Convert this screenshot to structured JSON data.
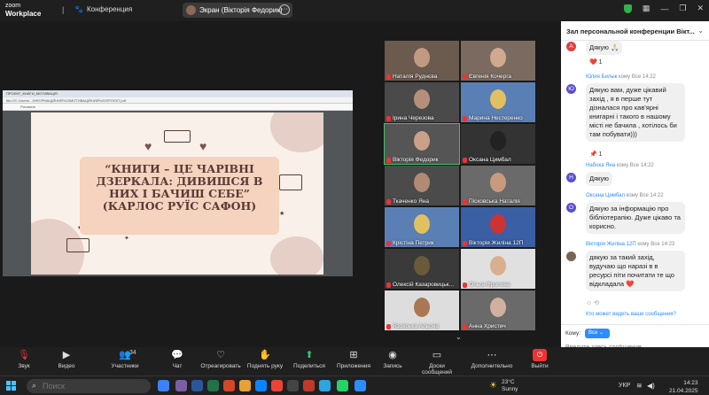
{
  "window": {
    "logo_line1": "zoom",
    "logo_line2": "Workplace",
    "conference_label": "Конференция",
    "screen_share_label": "Экран (Вікторія Федорик)"
  },
  "shared_screen": {
    "tab_title": "ПРОЄКТ_КНИГИ_МОТИВАЦІЯ",
    "address": "file:///C:/Users/...ІНФОРМАЦІЙНИЙ%20МОТИВАЦІЙНИЙ%20ПРОЄКТ.pdf",
    "pdf_toolbar": "Рисовать",
    "quote_line1": "“КНИГИ – ЦЕ ЧАРІВНІ",
    "quote_line2": "ДЗЕРКАЛА: ДИВИШСЯ В",
    "quote_line3": "НИХ І БАЧИШ СЕБЕ”",
    "quote_line4": "(КАРЛОС РУЇС САФОН)"
  },
  "participants": [
    {
      "name": "Наталія Руднєва",
      "face": "#c29a82",
      "bg": "#6b5a4e"
    },
    {
      "name": "Євгенія Кочерга",
      "face": "#d1a98f",
      "bg": "#7a6a60"
    },
    {
      "name": "Ірина Черезова",
      "face": "#b58f7a",
      "bg": "#4a4a4a"
    },
    {
      "name": "Марина Нестеренко",
      "face": "#e0c060",
      "bg": "#5a7fb5"
    },
    {
      "name": "Вікторія Федорик",
      "face": "#caa088",
      "bg": "#555"
    },
    {
      "name": "Оксана Цимбал",
      "face": "#222",
      "bg": "#333"
    },
    {
      "name": "Ткаченко Яна",
      "face": "#b08a72",
      "bg": "#4b4b4b"
    },
    {
      "name": "Пісковська Наталія",
      "face": "#c99a7e",
      "bg": "#6a6a6a"
    },
    {
      "name": "Крістіна Петрик",
      "face": "#e0c060",
      "bg": "#5a7fb5"
    },
    {
      "name": "Вікторія Жиліна 12П",
      "face": "#cc3333",
      "bg": "#3a5fa5"
    },
    {
      "name": "Олексій Казаровицьк...",
      "face": "#6a5a3a",
      "bg": "#3a3a3a"
    },
    {
      "name": "Ольга Фролова",
      "face": "#d8b090",
      "bg": "#e0e0e0"
    },
    {
      "name": "Язовська Альона",
      "face": "#aa7755",
      "bg": "#dddddd"
    },
    {
      "name": "Анна Христич",
      "face": "#d0b0a0",
      "bg": "#6a6a6a"
    }
  ],
  "chat": {
    "title": "Зал персональной конференции Вікт...",
    "messages": [
      {
        "avatar": "А",
        "avatar_color": "#e04040",
        "sender": "",
        "meta": "",
        "text": "Дякую 🙏🏻",
        "reaction": "❤️ 1"
      },
      {
        "avatar": "Ю",
        "avatar_color": "#5a4fcf",
        "sender": "Юлия Билык",
        "meta": " кому Все  14:22",
        "text": "Дякую вам, дуже цікавий захід , я в перше тут дізналася  про кав'ярні книгарні і такого в нашому місті не бачила , хотілось би там побувати)))",
        "reaction": "📌 1"
      },
      {
        "avatar": "Н",
        "avatar_color": "#5a4fcf",
        "sender": "Набока Яна",
        "meta": " кому Все  14:22",
        "text": "Дякую",
        "reaction": ""
      },
      {
        "avatar": "О",
        "avatar_color": "#5a4fcf",
        "sender": "Оксана Цимбал",
        "meta": " кому Все  14:22",
        "text": "Дякую за інформацію про бібліотерапію. Дуже цікаво та корисно.",
        "reaction": ""
      },
      {
        "avatar": "",
        "avatar_color": "#776655",
        "sender": "Вікторія Жиліна 12П",
        "meta": " кому Все  14:23",
        "text": "дякую за такий захід, вудучаю що наразі в в ресурсі піти почитати те що відкладала ❤️",
        "reaction": ""
      }
    ],
    "who_can_see": "Кто может видеть ваши сообщения?",
    "to_label": "Кому:",
    "to_value": "Все",
    "input_placeholder": "Введите здесь сообщение..."
  },
  "toolbar": {
    "audio": "Звук",
    "video": "Видео",
    "participants": "Участники",
    "participants_count": "34",
    "chat": "Чат",
    "react": "Отреагировать",
    "raise_hand": "Поднять руку",
    "share": "Поделиться",
    "apps": "Приложения",
    "record": "Запись",
    "whiteboards": "Доски сообщений",
    "more": "Дополнительно",
    "exit": "Выйти"
  },
  "taskbar": {
    "search_placeholder": "Поиск",
    "weather_temp": "23°C",
    "weather_desc": "Sunny",
    "lang": "УКР",
    "time": "14:23",
    "date": "21.04.2025"
  }
}
